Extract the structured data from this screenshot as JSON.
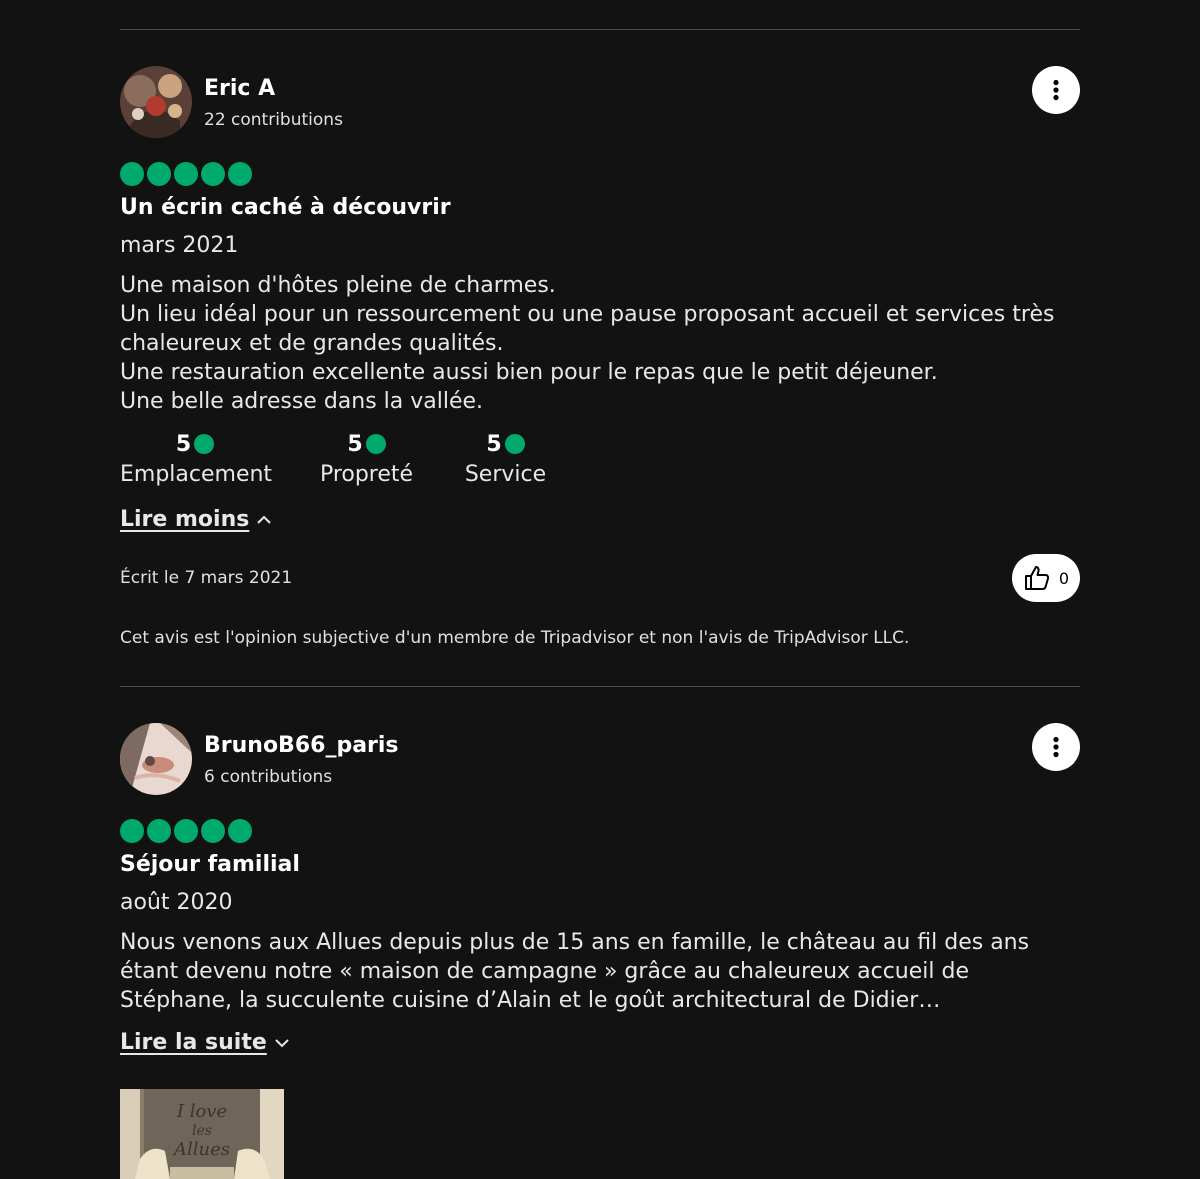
{
  "colors": {
    "background": "#121212",
    "bubble_green": "#00aa6c",
    "text": "#e8e8e8"
  },
  "icons": {
    "more": "three-dots-vertical-icon",
    "helpful": "thumbs-up-icon",
    "chevron_up": "chevron-up-icon",
    "chevron_down": "chevron-down-icon"
  },
  "reviews": [
    {
      "author": "Eric A",
      "contributions": "22 contributions",
      "rating": 5,
      "title": "Un écrin caché à découvrir",
      "trip_date": "mars 2021",
      "text_lines": [
        "Une maison d'hôtes pleine de charmes.",
        "Un lieu idéal pour un ressourcement ou une pause proposant accueil et services très chaleureux et de grandes qualités.",
        "Une restauration excellente aussi bien pour le repas que le petit déjeuner.",
        "Une belle adresse dans la vallée."
      ],
      "subratings": [
        {
          "value": "5",
          "label": "Emplacement"
        },
        {
          "value": "5",
          "label": "Propreté"
        },
        {
          "value": "5",
          "label": "Service"
        }
      ],
      "toggle_label": "Lire moins",
      "written_date": "Écrit le 7 mars 2021",
      "helpful_count": "0",
      "disclaimer": "Cet avis est l'opinion subjective d'un membre de Tripadvisor et non l'avis de TripAdvisor LLC."
    },
    {
      "author": "BrunoB66_paris",
      "contributions": "6 contributions",
      "rating": 5,
      "title": "Séjour familial",
      "trip_date": "août 2020",
      "text": "Nous venons aux Allues depuis plus de 15 ans en famille, le château au fil des ans étant devenu notre « maison de campagne » grâce au chaleureux accueil de Stéphane, la succulente cuisine d’Alain et le goût architectural de Didier…",
      "toggle_label": "Lire la suite",
      "photo_caption": "I love les Allues"
    }
  ]
}
